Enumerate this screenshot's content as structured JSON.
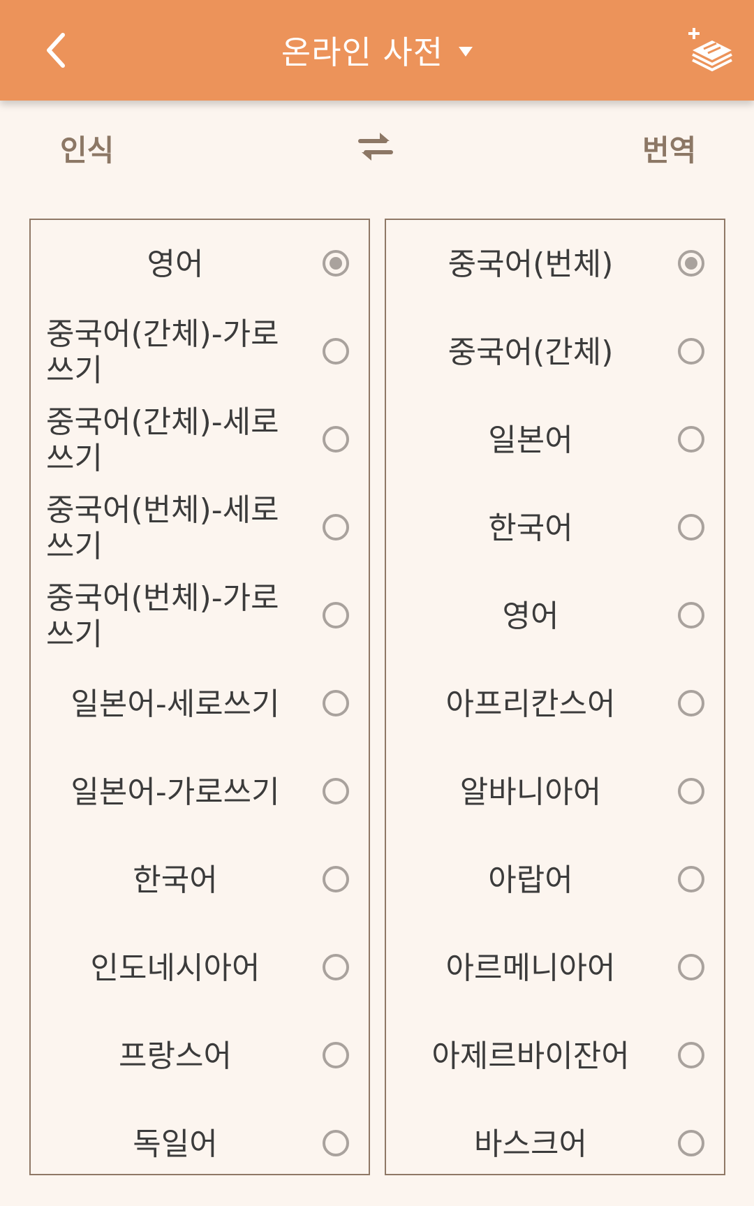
{
  "header": {
    "title": "온라인 사전",
    "colors": {
      "appbar": "#ec935a",
      "text": "#ffffff"
    },
    "icons": {
      "back": "chevron-left-icon",
      "dropdown": "caret-down-icon",
      "dictionary": "add-book-icon"
    }
  },
  "tabs": {
    "recognize": "인식",
    "translate": "번역",
    "swap_icon": "swap-arrows-icon"
  },
  "source_languages": [
    {
      "label": "영어",
      "selected": true
    },
    {
      "label": "중국어(간체)-가로쓰기",
      "selected": false
    },
    {
      "label": "중국어(간체)-세로쓰기",
      "selected": false
    },
    {
      "label": "중국어(번체)-세로쓰기",
      "selected": false
    },
    {
      "label": "중국어(번체)-가로쓰기",
      "selected": false
    },
    {
      "label": "일본어-세로쓰기",
      "selected": false
    },
    {
      "label": "일본어-가로쓰기",
      "selected": false
    },
    {
      "label": "한국어",
      "selected": false
    },
    {
      "label": "인도네시아어",
      "selected": false
    },
    {
      "label": "프랑스어",
      "selected": false
    },
    {
      "label": "독일어",
      "selected": false
    }
  ],
  "target_languages": [
    {
      "label": "중국어(번체)",
      "selected": true
    },
    {
      "label": "중국어(간체)",
      "selected": false
    },
    {
      "label": "일본어",
      "selected": false
    },
    {
      "label": "한국어",
      "selected": false
    },
    {
      "label": "영어",
      "selected": false
    },
    {
      "label": "아프리칸스어",
      "selected": false
    },
    {
      "label": "알바니아어",
      "selected": false
    },
    {
      "label": "아랍어",
      "selected": false
    },
    {
      "label": "아르메니아어",
      "selected": false
    },
    {
      "label": "아제르바이잔어",
      "selected": false
    },
    {
      "label": "바스크어",
      "selected": false
    }
  ]
}
